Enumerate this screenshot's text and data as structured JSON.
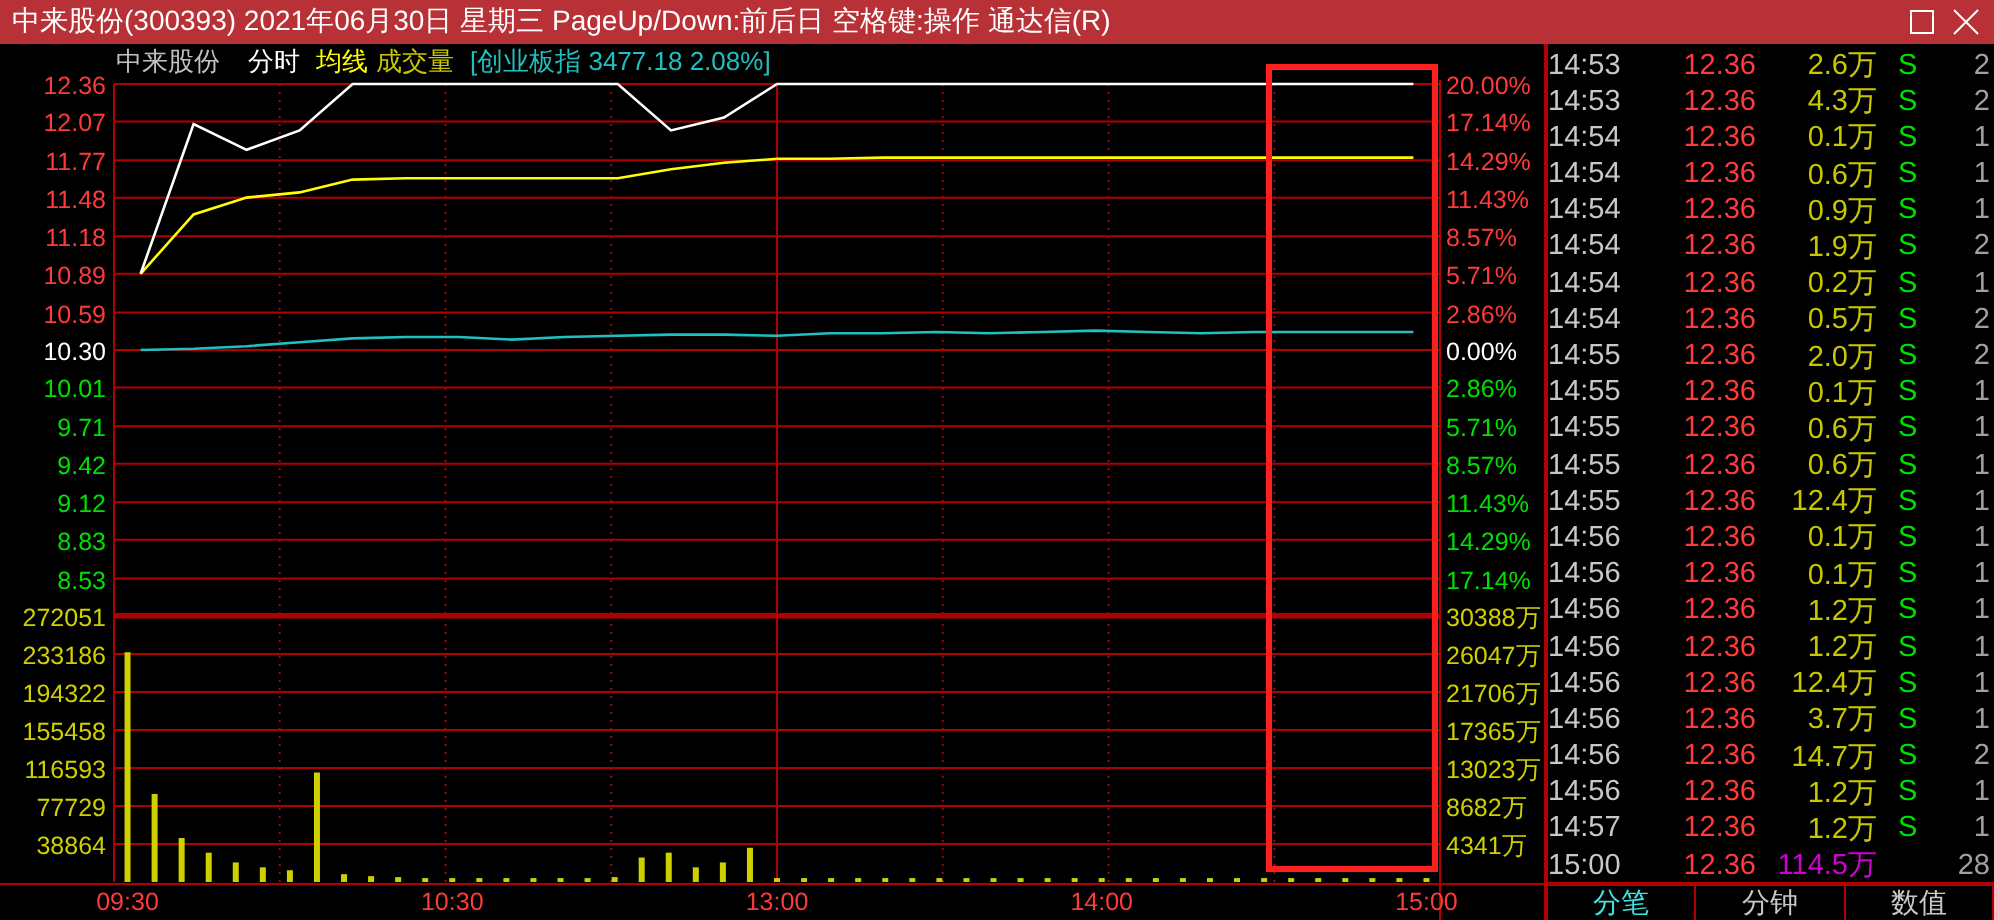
{
  "window": {
    "title": "中来股份(300393) 2021年06月30日 星期三 PageUp/Down:前后日 空格键:操作 通达信(R)"
  },
  "chart_header": {
    "stock": "中来股份",
    "volume_label": "成交量",
    "index": "[创业板指 3477.18 2.08%]"
  },
  "price_chart": {
    "chart_data": {
      "type": "line",
      "categories": [
        null,
        null,
        null,
        null,
        null,
        null,
        null,
        null,
        null,
        null,
        null,
        null,
        null,
        null,
        null,
        null,
        null,
        null,
        null,
        null,
        null,
        null,
        null,
        null,
        null
      ],
      "series": [
        {
          "name": "分时",
          "color": "#ffffff",
          "values": [
            10.89,
            12.05,
            11.85,
            12.0,
            12.36,
            12.36,
            12.36,
            12.36,
            12.36,
            12.36,
            12.0,
            12.1,
            12.36,
            12.36,
            12.36,
            12.36,
            12.36,
            12.36,
            12.36,
            12.36,
            12.36,
            12.36,
            12.36,
            12.36,
            12.36
          ]
        },
        {
          "name": "均线",
          "color": "#ffff00",
          "values": [
            10.89,
            11.35,
            11.48,
            11.52,
            11.62,
            11.63,
            11.63,
            11.63,
            11.63,
            11.63,
            11.7,
            11.75,
            11.78,
            11.78,
            11.79,
            11.79,
            11.79,
            11.79,
            11.79,
            11.79,
            11.79,
            11.79,
            11.79,
            11.79,
            11.79
          ]
        },
        {
          "color": "#20c0c0",
          "values": [
            10.3,
            10.31,
            10.33,
            10.36,
            10.39,
            10.4,
            10.4,
            10.38,
            10.4,
            10.41,
            10.42,
            10.42,
            10.41,
            10.43,
            10.43,
            10.44,
            10.43,
            10.44,
            10.45,
            10.44,
            10.43,
            10.44,
            10.44,
            10.44,
            10.44
          ]
        }
      ],
      "ylim": [
        8.24,
        12.36
      ],
      "grid": true,
      "yticks": [
        {
          "value": 12.36,
          "label": "12.36"
        },
        {
          "value": 12.07,
          "label": "12.07"
        },
        {
          "value": 11.77,
          "label": "11.77"
        },
        {
          "value": 11.48,
          "label": "11.48"
        },
        {
          "value": 11.18,
          "label": "11.18"
        },
        {
          "value": 10.89,
          "label": "10.89"
        },
        {
          "value": 10.59,
          "label": "10.59"
        },
        {
          "value": 10.3,
          "label": "10.30"
        },
        {
          "value": 10.01,
          "label": "10.01"
        },
        {
          "value": 9.71,
          "label": "9.71"
        },
        {
          "value": 9.42,
          "label": "9.42"
        },
        {
          "value": 9.12,
          "label": "9.12"
        },
        {
          "value": 8.83,
          "label": "8.83"
        },
        {
          "value": 8.53,
          "label": "8.53"
        }
      ]
    },
    "right_ticks": [
      "20.00%",
      "17.14%",
      "14.29%",
      "11.43%",
      "8.57%",
      "5.71%",
      "2.86%",
      "0.00%",
      "2.86%",
      "5.71%",
      "8.57%",
      "11.43%",
      "14.29%",
      "17.14%"
    ]
  },
  "volume_chart": {
    "chart_data": {
      "type": "bar",
      "categories": [
        "09:30",
        null,
        null,
        null,
        null,
        null,
        null,
        null,
        null,
        null,
        null,
        null,
        "10:30",
        null,
        null,
        null,
        null,
        null,
        null,
        null,
        null,
        null,
        null,
        null,
        "13:00",
        null,
        null,
        null,
        null,
        null,
        null,
        null,
        null,
        null,
        null,
        null,
        "14:00",
        null,
        null,
        null,
        null,
        null,
        null,
        null,
        null,
        null,
        null,
        null,
        "15:00"
      ],
      "values": [
        235000,
        90000,
        45000,
        30000,
        20000,
        15000,
        12000,
        112000,
        8000,
        6000,
        5000,
        4000,
        4000,
        4000,
        4000,
        4000,
        4000,
        4000,
        5000,
        25000,
        30000,
        15000,
        20000,
        35000,
        4000,
        4000,
        4000,
        4000,
        4000,
        4000,
        4000,
        4000,
        4000,
        4000,
        4000,
        4000,
        4000,
        4000,
        4000,
        4000,
        4000,
        4000,
        4000,
        4000,
        4000,
        4000,
        4000,
        4000,
        4000
      ],
      "ylim": [
        0,
        272051
      ],
      "grid": true,
      "yticks": [
        272051,
        233186,
        194322,
        155458,
        116593,
        77729,
        38864
      ]
    },
    "right_ticks": [
      "30388万",
      "26047万",
      "21706万",
      "17365万",
      "13023万",
      "8682万",
      "4341万"
    ]
  },
  "ticks_list": {
    "rows": [
      {
        "kind": "trade",
        "time": "14:53",
        "price": "12.36",
        "volume": "2.6万",
        "side": "S",
        "count": "2"
      },
      {
        "kind": "trade",
        "time": "14:53",
        "price": "12.36",
        "volume": "4.3万",
        "side": "S",
        "count": "2"
      },
      {
        "kind": "trade",
        "time": "14:54",
        "price": "12.36",
        "volume": "0.1万",
        "side": "S",
        "count": "1"
      },
      {
        "kind": "trade",
        "time": "14:54",
        "price": "12.36",
        "volume": "0.6万",
        "side": "S",
        "count": "1"
      },
      {
        "kind": "trade",
        "time": "14:54",
        "price": "12.36",
        "volume": "0.9万",
        "side": "S",
        "count": "1"
      },
      {
        "kind": "trade",
        "time": "14:54",
        "price": "12.36",
        "volume": "1.9万",
        "side": "S",
        "count": "2"
      },
      {
        "kind": "trade",
        "time": "14:54",
        "price": "12.36",
        "volume": "0.2万",
        "side": "S",
        "count": "1"
      },
      {
        "kind": "trade",
        "time": "14:54",
        "price": "12.36",
        "volume": "0.5万",
        "side": "S",
        "count": "2"
      },
      {
        "kind": "trade",
        "time": "14:55",
        "price": "12.36",
        "volume": "2.0万",
        "side": "S",
        "count": "2"
      },
      {
        "kind": "trade",
        "time": "14:55",
        "price": "12.36",
        "volume": "0.1万",
        "side": "S",
        "count": "1"
      },
      {
        "kind": "trade",
        "time": "14:55",
        "price": "12.36",
        "volume": "0.6万",
        "side": "S",
        "count": "1"
      },
      {
        "kind": "trade",
        "time": "14:55",
        "price": "12.36",
        "volume": "0.6万",
        "side": "S",
        "count": "1"
      },
      {
        "kind": "trade",
        "time": "14:55",
        "price": "12.36",
        "volume": "12.4万",
        "side": "S",
        "count": "1"
      },
      {
        "kind": "trade",
        "time": "14:56",
        "price": "12.36",
        "volume": "0.1万",
        "side": "S",
        "count": "1"
      },
      {
        "kind": "trade",
        "time": "14:56",
        "price": "12.36",
        "volume": "0.1万",
        "side": "S",
        "count": "1"
      },
      {
        "kind": "trade",
        "time": "14:56",
        "price": "12.36",
        "volume": "1.2万",
        "side": "S",
        "count": "1"
      },
      {
        "kind": "trade",
        "time": "14:56",
        "price": "12.36",
        "volume": "1.2万",
        "side": "S",
        "count": "1"
      },
      {
        "kind": "trade",
        "time": "14:56",
        "price": "12.36",
        "volume": "12.4万",
        "side": "S",
        "count": "1"
      },
      {
        "kind": "trade",
        "time": "14:56",
        "price": "12.36",
        "volume": "3.7万",
        "side": "S",
        "count": "1"
      },
      {
        "kind": "trade",
        "time": "14:56",
        "price": "12.36",
        "volume": "14.7万",
        "side": "S",
        "count": "2"
      },
      {
        "kind": "trade",
        "time": "14:56",
        "price": "12.36",
        "volume": "1.2万",
        "side": "S",
        "count": "1"
      },
      {
        "kind": "trade",
        "time": "14:57",
        "price": "12.36",
        "volume": "1.2万",
        "side": "S",
        "count": "1"
      },
      {
        "kind": "close",
        "time": "15:00",
        "price": "12.36",
        "volume": "114.5万",
        "count": "28"
      }
    ]
  },
  "bottom_tabs": [
    {
      "label": "分笔",
      "selected": true
    },
    {
      "label": "分钟",
      "selected": false
    },
    {
      "label": "数值",
      "selected": false
    }
  ]
}
